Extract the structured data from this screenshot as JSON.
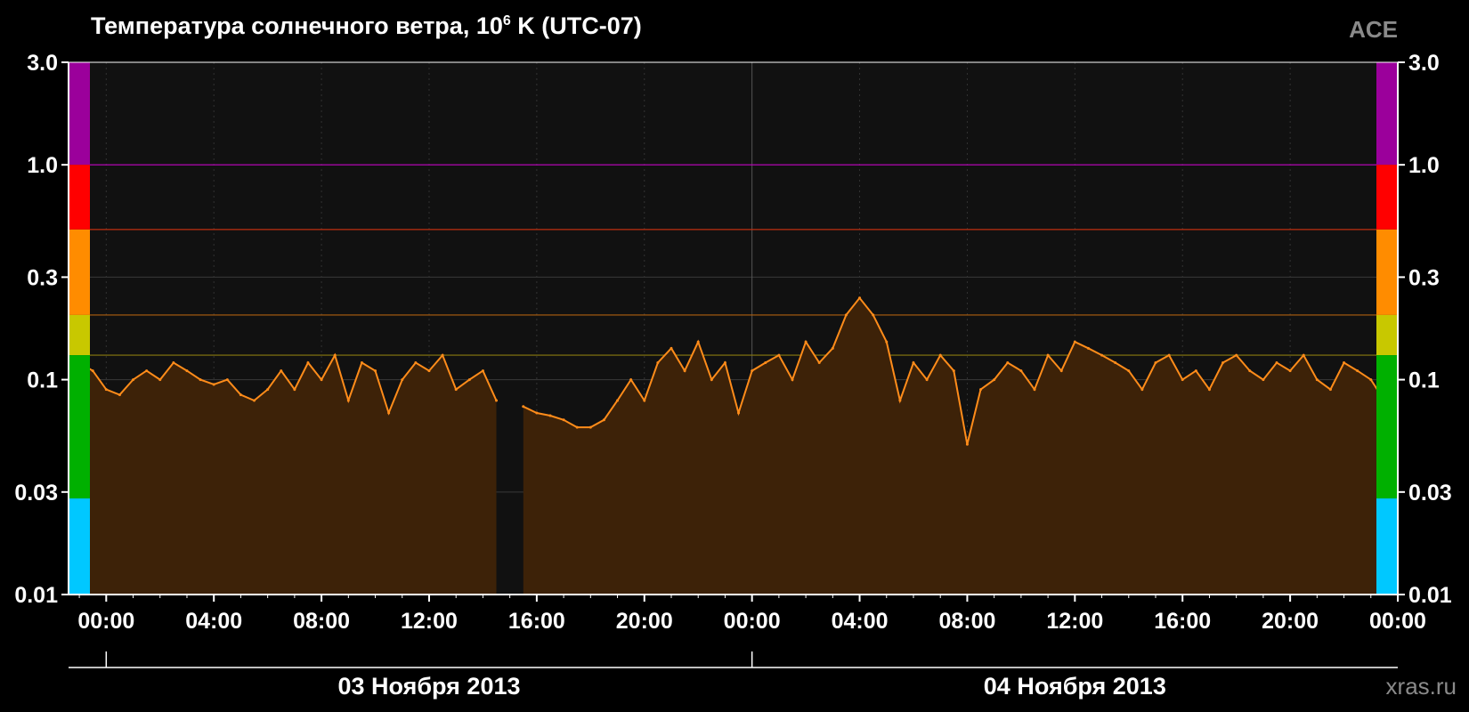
{
  "chart_data": {
    "type": "area",
    "title": "Температура солнечного ветра, 10",
    "title_sup": "6",
    "title_suffix": " K (UTC-07)",
    "source": "ACE",
    "site": "xras.ru",
    "y_scale": "log",
    "ylim": [
      0.01,
      3.0
    ],
    "y_ticks": [
      "3.0",
      "1.0",
      "0.3",
      "0.1",
      "0.03",
      "0.01"
    ],
    "y_tick_values": [
      3.0,
      1.0,
      0.3,
      0.1,
      0.03,
      0.01
    ],
    "xlim_hours": [
      -1.4,
      48.0
    ],
    "x_tick_labels": [
      "00:00",
      "04:00",
      "08:00",
      "12:00",
      "16:00",
      "20:00",
      "00:00",
      "04:00",
      "08:00",
      "12:00",
      "16:00",
      "20:00",
      "00:00"
    ],
    "x_tick_hours": [
      0,
      4,
      8,
      12,
      16,
      20,
      24,
      28,
      32,
      36,
      40,
      44,
      48
    ],
    "date_labels": [
      {
        "text": "03 Ноября 2013",
        "center_hour": 12
      },
      {
        "text": "04 Ноября 2013",
        "center_hour": 36
      }
    ],
    "threshold_lines": [
      {
        "value": 1.0,
        "color": "#c000c0"
      },
      {
        "value": 0.5,
        "color": "#c03010"
      },
      {
        "value": 0.2,
        "color": "#b06010"
      },
      {
        "value": 0.13,
        "color": "#8a7a10"
      }
    ],
    "color_scale": [
      {
        "from": 1.0,
        "to": 3.0,
        "color": "#9b009b"
      },
      {
        "from": 0.5,
        "to": 1.0,
        "color": "#ff0000"
      },
      {
        "from": 0.2,
        "to": 0.5,
        "color": "#ff8c00"
      },
      {
        "from": 0.13,
        "to": 0.2,
        "color": "#c8c800"
      },
      {
        "from": 0.028,
        "to": 0.13,
        "color": "#00b000"
      },
      {
        "from": 0.01,
        "to": 0.028,
        "color": "#00c8ff"
      }
    ],
    "series": [
      {
        "color": "#ff8c1a",
        "fill": "#3d2208",
        "x_hours": [
          -1.0,
          -0.5,
          0,
          0.5,
          1,
          1.5,
          2,
          2.5,
          3,
          3.5,
          4,
          4.5,
          5,
          5.5,
          6,
          6.5,
          7,
          7.5,
          8,
          8.5,
          9,
          9.5,
          10,
          10.5,
          11,
          11.5,
          12,
          12.5,
          13,
          13.5,
          14,
          14.5,
          15,
          15.5,
          16,
          16.5,
          17,
          17.5,
          18,
          18.5,
          19,
          19.5,
          20,
          20.5,
          21,
          21.5,
          22,
          22.5,
          23,
          23.5,
          24,
          24.5,
          25,
          25.5,
          26,
          26.5,
          27,
          27.5,
          28,
          28.5,
          29,
          29.5,
          30,
          30.5,
          31,
          31.5,
          32,
          32.5,
          33,
          33.5,
          34,
          34.5,
          35,
          35.5,
          36,
          36.5,
          37,
          37.5,
          38,
          38.5,
          39,
          39.5,
          40,
          40.5,
          41,
          41.5,
          42,
          42.5,
          43,
          43.5,
          44,
          44.5,
          45,
          45.5,
          46,
          46.5,
          47,
          47.5
        ],
        "values": [
          0.12,
          0.11,
          0.09,
          0.085,
          0.1,
          0.11,
          0.1,
          0.12,
          0.11,
          0.1,
          0.095,
          0.1,
          0.085,
          0.08,
          0.09,
          0.11,
          0.09,
          0.12,
          0.1,
          0.13,
          0.08,
          0.12,
          0.11,
          0.07,
          0.1,
          0.12,
          0.11,
          0.13,
          0.09,
          0.1,
          0.11,
          0.08,
          null,
          0.075,
          0.07,
          0.068,
          0.065,
          0.06,
          0.06,
          0.065,
          0.08,
          0.1,
          0.08,
          0.12,
          0.14,
          0.11,
          0.15,
          0.1,
          0.12,
          0.07,
          0.11,
          0.12,
          0.13,
          0.1,
          0.15,
          0.12,
          0.14,
          0.2,
          0.24,
          0.2,
          0.15,
          0.08,
          0.12,
          0.1,
          0.13,
          0.11,
          0.05,
          0.09,
          0.1,
          0.12,
          0.11,
          0.09,
          0.13,
          0.11,
          0.15,
          0.14,
          0.13,
          0.12,
          0.11,
          0.09,
          0.12,
          0.13,
          0.1,
          0.11,
          0.09,
          0.12,
          0.13,
          0.11,
          0.1,
          0.12,
          0.11,
          0.13,
          0.1,
          0.09,
          0.12,
          0.11,
          0.1,
          0.08,
          0.13
        ]
      }
    ],
    "gridlines": "horizontal and vertical, dark grey"
  }
}
